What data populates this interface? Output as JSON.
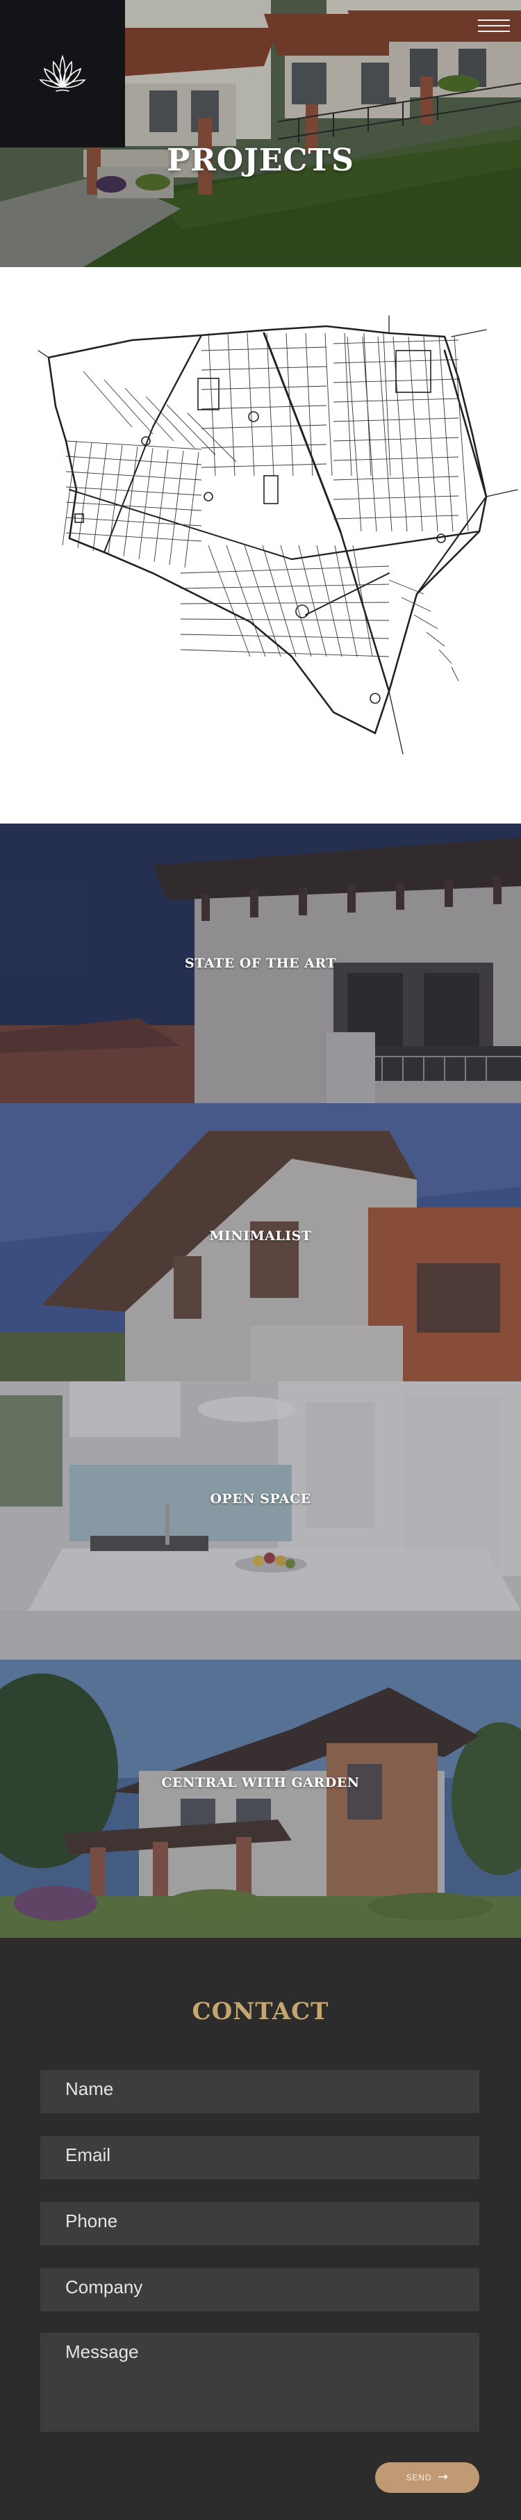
{
  "hero": {
    "title": "PROJECTS",
    "logo_icon": "lotus-logo-icon",
    "menu_icon": "hamburger-menu-icon"
  },
  "map": {
    "description_icon": "street-map-illustration"
  },
  "projects": [
    {
      "label": "STATE OF THE ART"
    },
    {
      "label": "MINIMALIST"
    },
    {
      "label": "OPEN SPACE"
    },
    {
      "label": "CENTRAL WITH GARDEN"
    }
  ],
  "contact": {
    "title": "CONTACT",
    "fields": {
      "name": "Name",
      "email": "Email",
      "phone": "Phone",
      "company": "Company",
      "message": "Message"
    },
    "send_label": "SEND",
    "send_icon": "arrow-right-icon"
  },
  "colors": {
    "accent_gold": "#c6a66f",
    "button": "#c09a74",
    "dark_bg": "#2d2c2c",
    "field_bg": "#3d3d3d",
    "logo_bg": "#141317"
  }
}
